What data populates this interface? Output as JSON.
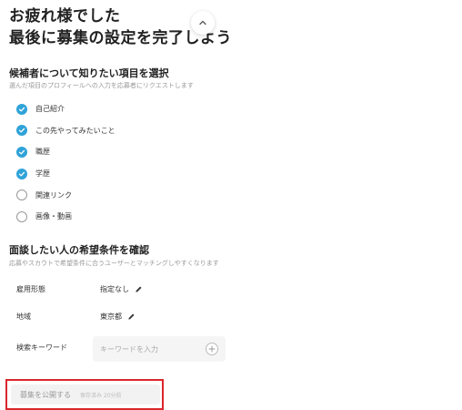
{
  "headline": {
    "line1": "お疲れ様でした",
    "line2": "最後に募集の設定を完了しよう"
  },
  "candidate_section": {
    "title": "候補者について知りたい項目を選択",
    "subtitle": "選んだ項目のプロフィールへの入力を応募者にリクエストします",
    "items": [
      {
        "label": "自己紹介",
        "checked": true
      },
      {
        "label": "この先やってみたいこと",
        "checked": true
      },
      {
        "label": "職歴",
        "checked": true
      },
      {
        "label": "学歴",
        "checked": true
      },
      {
        "label": "関連リンク",
        "checked": false
      },
      {
        "label": "画像・動画",
        "checked": false
      }
    ]
  },
  "conditions_section": {
    "title": "面談したい人の希望条件を確認",
    "subtitle": "応募やスカウトで希望条件に合うユーザーとマッチングしやすくなります",
    "employment_type": {
      "label": "雇用形態",
      "value": "指定なし"
    },
    "region": {
      "label": "地域",
      "value": "東京都"
    },
    "keyword": {
      "label": "検索キーワード",
      "placeholder": "キーワードを入力",
      "value": ""
    }
  },
  "publish": {
    "button_label": "募集を公開する",
    "save_status": "保存済み 20分前"
  },
  "colors": {
    "accent": "#2fa3d8",
    "highlight_border": "#d9262c"
  }
}
